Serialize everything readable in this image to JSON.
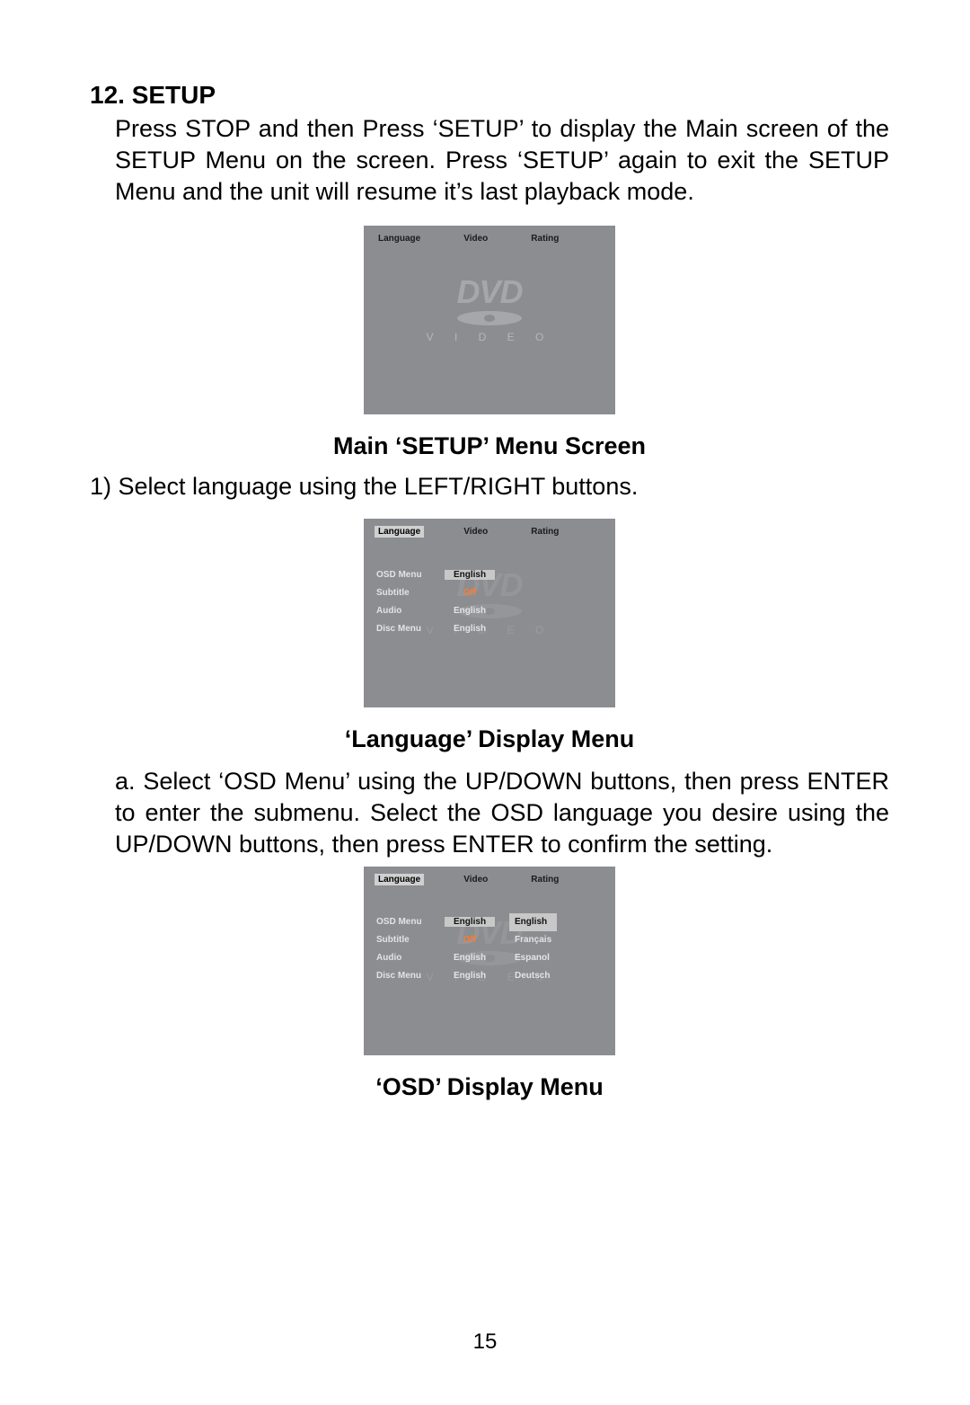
{
  "page_number": "15",
  "section": {
    "heading": "12. SETUP",
    "intro": "Press STOP and then Press ‘SETUP’ to display the Main screen of the SETUP Menu on the screen. Press ‘SETUP’ again to exit  the SETUP Menu and the unit  will resume it’s last playback mode.",
    "fig1_caption": "Main ‘SETUP’ Menu Screen",
    "step1": "1) Select language using the LEFT/RIGHT buttons.",
    "fig2_caption": "‘Language’ Display Menu",
    "step_a": "a. Select ‘OSD Menu’ using the UP/DOWN buttons, then press ENTER to enter  the submenu. Select  the OSD  language you desire using  the UP/DOWN buttons, then press ENTER to confirm the setting.",
    "fig3_caption": "‘OSD’ Display Menu"
  },
  "osd_common": {
    "tab1": "Language",
    "tab2": "Video",
    "tab3": "Rating",
    "logo_dvd": "DVD",
    "logo_video": "V I D E O"
  },
  "osd_lang_menu": {
    "rows": [
      {
        "label": "OSD Menu",
        "value": "English",
        "selected": true
      },
      {
        "label": "Subtitle",
        "value": "Off",
        "orange": true
      },
      {
        "label": "Audio",
        "value": "English"
      },
      {
        "label": "Disc Menu",
        "value": "English"
      }
    ]
  },
  "osd_osd_menu": {
    "rows": [
      {
        "label": "OSD Menu",
        "value": "English",
        "selected": true
      },
      {
        "label": "Subtitle",
        "value": "Off",
        "orange": true
      },
      {
        "label": "Audio",
        "value": "English"
      },
      {
        "label": "Disc Menu",
        "value": "English"
      }
    ],
    "submenu": [
      {
        "label": "English",
        "selected": true
      },
      {
        "label": "Français"
      },
      {
        "label": "Espanol"
      },
      {
        "label": "Deutsch"
      }
    ]
  }
}
